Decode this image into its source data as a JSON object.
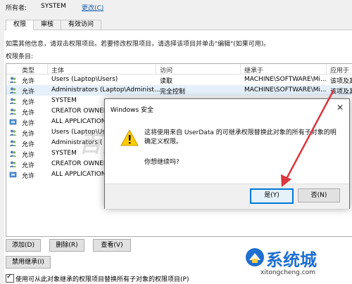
{
  "owner": {
    "label": "所有者:",
    "value": "SYSTEM",
    "change_link": "更改(C)"
  },
  "tabs": [
    {
      "label": "权限",
      "active": true
    },
    {
      "label": "审核",
      "active": false
    },
    {
      "label": "有效访问",
      "active": false
    }
  ],
  "info_text": "如需其他信息，请双击权限项目。若要修改权限项目，请选择该项目并单击\"编辑\"(如果可用)。",
  "entries_label": "权限条目:",
  "table": {
    "headers": [
      "类型",
      "主体",
      "访问",
      "继承于",
      "应用于"
    ],
    "rows": [
      {
        "type": "允许",
        "principal": "Users (Laptop\\Users)",
        "access": "读取",
        "inherited": "MACHINE\\SOFTWARE\\Mi...",
        "applies": "该项及其",
        "icon": "users-icon"
      },
      {
        "type": "允许",
        "principal": "Administrators (Laptop\\Administ...",
        "access": "完全控制",
        "inherited": "MACHINE\\SOFTWARE\\Mi...",
        "applies": "该项及其",
        "icon": "users-icon",
        "selected": true
      },
      {
        "type": "允许",
        "principal": "SYSTEM",
        "access": "",
        "inherited": "",
        "applies": "",
        "icon": "users-icon"
      },
      {
        "type": "允许",
        "principal": "CREATOR OWNER",
        "access": "",
        "inherited": "",
        "applies": "",
        "icon": "users-icon"
      },
      {
        "type": "允许",
        "principal": "ALL APPLICATION",
        "access": "",
        "inherited": "",
        "applies": "",
        "icon": "package-icon"
      },
      {
        "type": "允许",
        "principal": "Users (Laptop\\Users)",
        "access": "",
        "inherited": "",
        "applies": "",
        "icon": "users-icon"
      },
      {
        "type": "允许",
        "principal": "Administrators (",
        "access": "",
        "inherited": "",
        "applies": "",
        "icon": "users-icon"
      },
      {
        "type": "允许",
        "principal": "SYSTEM",
        "access": "",
        "inherited": "",
        "applies": "",
        "icon": "users-icon"
      },
      {
        "type": "允许",
        "principal": "CREATOR OWNER",
        "access": "",
        "inherited": "",
        "applies": "",
        "icon": "users-icon"
      },
      {
        "type": "允许",
        "principal": "ALL APPLICATION",
        "access": "",
        "inherited": "",
        "applies": "",
        "icon": "package-icon"
      }
    ]
  },
  "buttons": {
    "add": "添加(D)",
    "remove": "删除(R)",
    "view": "查看(V)",
    "disable_inherit": "禁用继承(I)"
  },
  "replace_checkbox": {
    "label": "使用可从此对象继承的权限项目替换所有子对象的权限项目(P)",
    "checked": true
  },
  "dialog": {
    "title": "Windows 安全",
    "message": "这将使用来自 UserData 的可继承权限替换此对象的所有子对象的明确定义权限。",
    "question": "你想继续吗?",
    "yes": "是(Y)",
    "no": "否(N)"
  },
  "watermark": "百度ID gu0zi",
  "logo": {
    "name": "系统城",
    "url": "xitongcheng.com"
  },
  "colors": {
    "accent": "#0078d7",
    "arrow": "#d9363e",
    "selected_row": "#e5f0fb",
    "logo_blue": "#1f6fd0"
  }
}
